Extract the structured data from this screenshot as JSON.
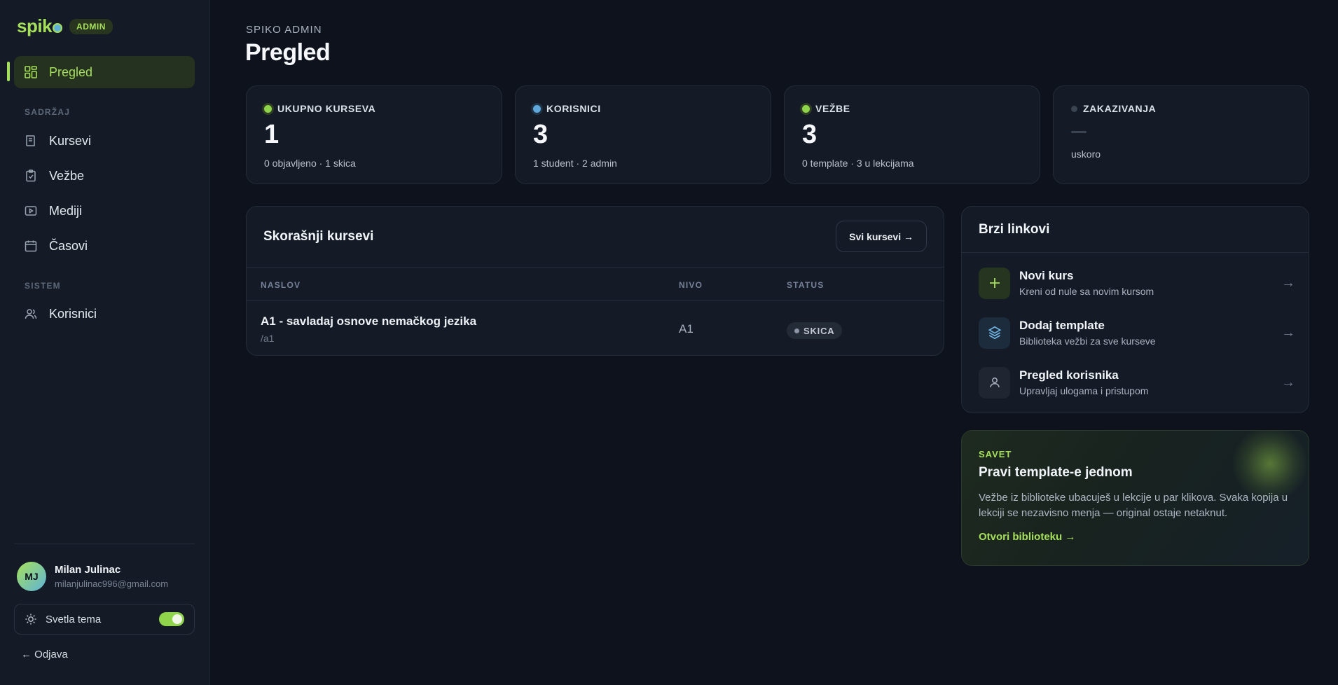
{
  "brand": {
    "logo": "spik",
    "badge": "ADMIN"
  },
  "sidebar": {
    "items": [
      {
        "label": "Pregled",
        "icon": "grid-icon",
        "active": true
      },
      {
        "label": "Kursevi",
        "icon": "book-icon"
      },
      {
        "label": "Vežbe",
        "icon": "clipboard-icon"
      },
      {
        "label": "Mediji",
        "icon": "video-icon"
      },
      {
        "label": "Časovi",
        "icon": "calendar-icon"
      },
      {
        "label": "Korisnici",
        "icon": "users-icon"
      }
    ],
    "sections": {
      "content": "SADRŽAJ",
      "system": "SISTEM"
    }
  },
  "user": {
    "initials": "MJ",
    "name": "Milan Julinac",
    "email": "milanjulinac996@gmail.com"
  },
  "theme": {
    "label": "Svetla tema",
    "enabled": true
  },
  "logout": "← Odjava",
  "header": {
    "crumb": "SPIKO ADMIN",
    "title": "Pregled"
  },
  "stats": [
    {
      "label": "UKUPNO KURSEVA",
      "value": "1",
      "sub": "0 objavljeno · 1 skica",
      "color": "#8fd44a"
    },
    {
      "label": "KORISNICI",
      "value": "3",
      "sub": "1 student · 2 admin",
      "color": "#5fa8dc"
    },
    {
      "label": "VEŽBE",
      "value": "3",
      "sub": "0 template · 3 u lekcijama",
      "color": "#8fd44a"
    },
    {
      "label": "ZAKAZIVANJA",
      "value": "",
      "sub": "uskoro",
      "color": "#3a4452"
    }
  ],
  "recent": {
    "title": "Skorašnji kursevi",
    "all_button": "Svi kursevi →",
    "columns": [
      "NASLOV",
      "NIVO",
      "STATUS"
    ],
    "rows": [
      {
        "title": "A1 - savladaj osnove nemačkog jezika",
        "slug": "/a1",
        "level": "A1",
        "status": "SKICA"
      }
    ]
  },
  "quick": {
    "title": "Brzi linkovi",
    "links": [
      {
        "title": "Novi kurs",
        "sub": "Kreni od nule sa novim kursom",
        "icon": "plus-icon",
        "arrow": "→"
      },
      {
        "title": "Dodaj template",
        "sub": "Biblioteka vežbi za sve kurseve",
        "icon": "layers-icon",
        "arrow": "→"
      },
      {
        "title": "Pregled korisnika",
        "sub": "Upravljaj ulogama i pristupom",
        "icon": "user-icon",
        "arrow": "→"
      }
    ]
  },
  "tip": {
    "label": "SAVET",
    "title": "Pravi template-e jednom",
    "body": "Vežbe iz biblioteke ubacuješ u lekcije u par klikova. Svaka kopija u lekciji se nezavisno menja — original ostaje netaknut.",
    "link": "Otvori biblioteku →"
  },
  "colors": {
    "accent": "#a6e05a",
    "bg": "#0d121c",
    "panel": "#141b26"
  }
}
